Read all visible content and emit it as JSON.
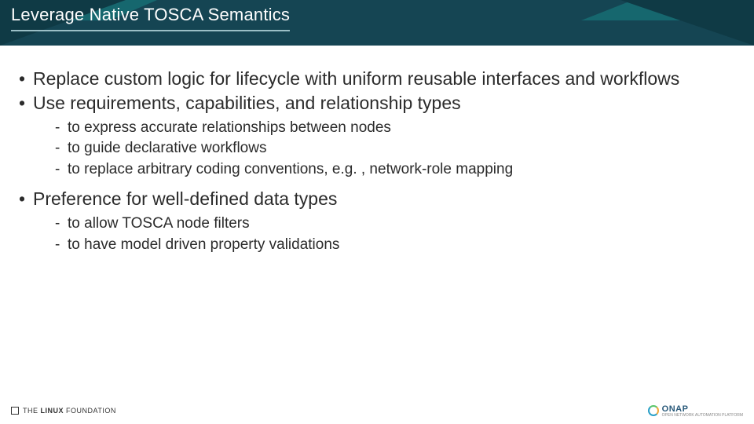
{
  "header": {
    "title": "Leverage Native TOSCA Semantics"
  },
  "bullets": [
    {
      "text": "Replace custom logic for lifecycle with uniform reusable interfaces and workflows",
      "sub": []
    },
    {
      "text": "Use requirements, capabilities, and relationship types",
      "sub": [
        "to express accurate relationships between nodes",
        "to guide declarative workflows",
        "to replace arbitrary coding conventions, e.g. , network-role mapping"
      ]
    },
    {
      "text": "Preference for well-defined data types",
      "sub": [
        "to allow TOSCA node filters",
        "to have model driven property validations"
      ]
    }
  ],
  "footer": {
    "linux_foundation_prefix": "THE",
    "linux_foundation_bold": "LINUX",
    "linux_foundation_suffix": "FOUNDATION",
    "onap_label": "ONAP",
    "onap_sub": "OPEN NETWORK AUTOMATION PLATFORM"
  }
}
